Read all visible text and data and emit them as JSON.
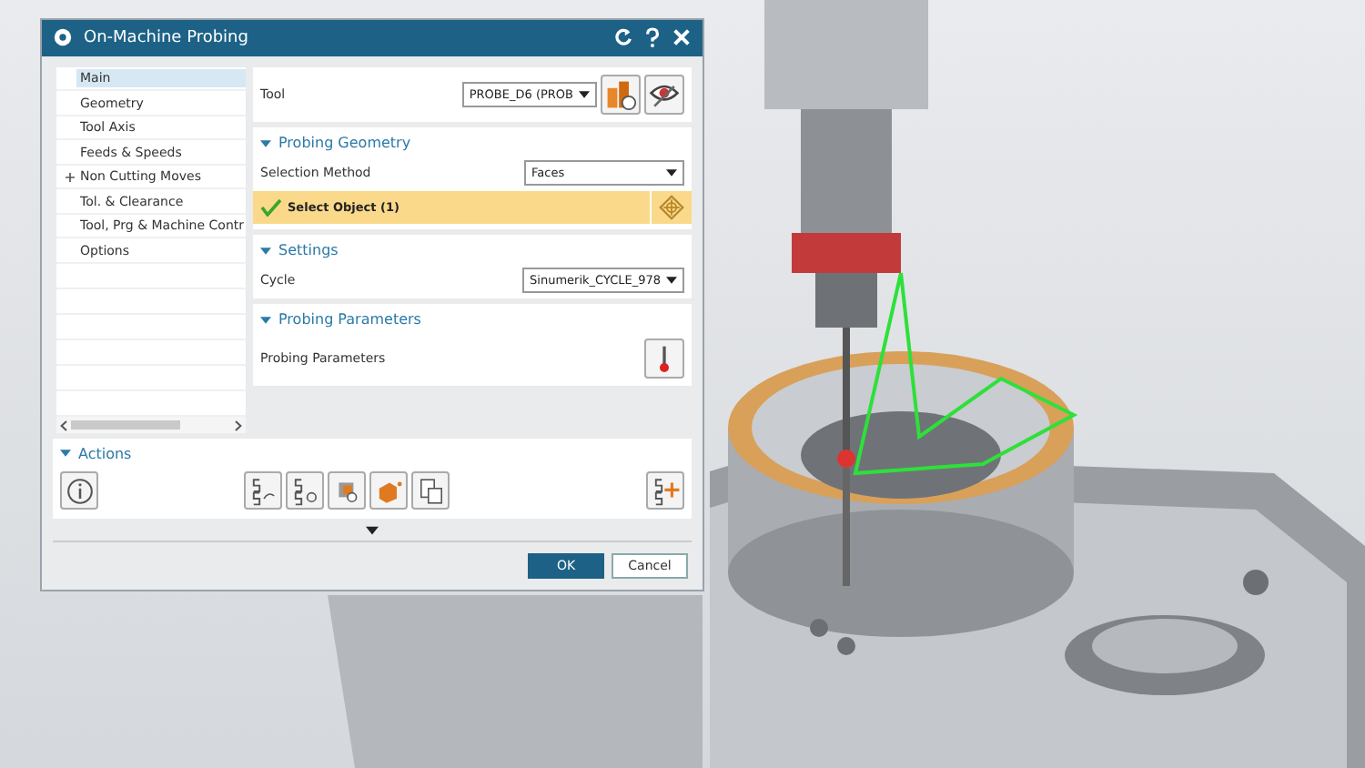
{
  "window": {
    "title": "On-Machine Probing"
  },
  "navigation": {
    "items": [
      {
        "label": "Main",
        "kind": "leaf",
        "selected": true
      },
      {
        "label": "Geometry",
        "kind": "leaf",
        "selected": false
      },
      {
        "label": "Tool Axis",
        "kind": "leaf",
        "selected": false
      },
      {
        "label": "Feeds & Speeds",
        "kind": "leaf",
        "selected": false
      },
      {
        "label": "Non Cutting Moves",
        "kind": "group",
        "selected": false
      },
      {
        "label": "Tol. & Clearance",
        "kind": "leaf",
        "selected": false
      },
      {
        "label": "Tool, Prg & Machine Contr",
        "kind": "leaf",
        "selected": false
      },
      {
        "label": "Options",
        "kind": "leaf",
        "selected": false
      }
    ]
  },
  "tool": {
    "label": "Tool",
    "value": "PROBE_D6 (PROB"
  },
  "sections": [
    {
      "title": "Probing Geometry",
      "expanded": true,
      "rows": [
        {
          "kind": "dropdown",
          "label": "Selection Method",
          "value": "Faces"
        },
        {
          "kind": "select",
          "label": "Select Object (1)",
          "checked": true
        }
      ]
    },
    {
      "title": "Settings",
      "expanded": true,
      "rows": [
        {
          "kind": "dropdown",
          "label": "Cycle",
          "value": "Sinumerik_CYCLE_978"
        }
      ]
    },
    {
      "title": "Probing Parameters",
      "expanded": true,
      "rows": [
        {
          "kind": "button",
          "label": "Probing Parameters"
        }
      ]
    }
  ],
  "actions": {
    "title": "Actions",
    "expanded": true
  },
  "buttons": [
    {
      "label": "OK",
      "kind": "primary"
    },
    {
      "label": "Cancel",
      "kind": "secondary"
    }
  ]
}
